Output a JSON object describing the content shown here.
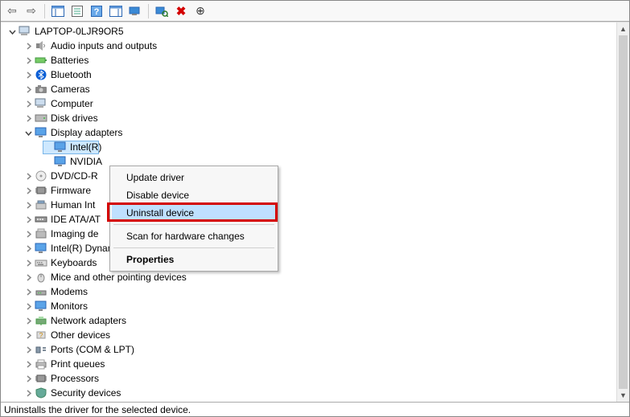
{
  "root_label": "LAPTOP-0LJR9OR5",
  "categories": [
    {
      "label": "Audio inputs and outputs",
      "expanded": false,
      "children": []
    },
    {
      "label": "Batteries",
      "expanded": false,
      "children": []
    },
    {
      "label": "Bluetooth",
      "expanded": false,
      "children": []
    },
    {
      "label": "Cameras",
      "expanded": false,
      "children": []
    },
    {
      "label": "Computer",
      "expanded": false,
      "children": []
    },
    {
      "label": "Disk drives",
      "expanded": false,
      "children": []
    },
    {
      "label": "Display adapters",
      "expanded": true,
      "children": [
        {
          "label": "Intel(R)",
          "selected": true
        },
        {
          "label": "NVIDIA"
        }
      ]
    },
    {
      "label": "DVD/CD-R",
      "expanded": false,
      "children": []
    },
    {
      "label": "Firmware",
      "expanded": false,
      "children": []
    },
    {
      "label": "Human Int",
      "expanded": false,
      "children": []
    },
    {
      "label": "IDE ATA/AT",
      "expanded": false,
      "children": []
    },
    {
      "label": "Imaging de",
      "expanded": false,
      "children": []
    },
    {
      "label": "Intel(R) Dynamic Platform and Thermal Framework",
      "expanded": false,
      "children": []
    },
    {
      "label": "Keyboards",
      "expanded": false,
      "children": []
    },
    {
      "label": "Mice and other pointing devices",
      "expanded": false,
      "children": []
    },
    {
      "label": "Modems",
      "expanded": false,
      "children": []
    },
    {
      "label": "Monitors",
      "expanded": false,
      "children": []
    },
    {
      "label": "Network adapters",
      "expanded": false,
      "children": []
    },
    {
      "label": "Other devices",
      "expanded": false,
      "children": []
    },
    {
      "label": "Ports (COM & LPT)",
      "expanded": false,
      "children": []
    },
    {
      "label": "Print queues",
      "expanded": false,
      "children": []
    },
    {
      "label": "Processors",
      "expanded": false,
      "children": []
    },
    {
      "label": "Security devices",
      "expanded": false,
      "children": []
    }
  ],
  "context_menu": {
    "items": [
      {
        "label": "Update driver",
        "type": "item"
      },
      {
        "label": "Disable device",
        "type": "item"
      },
      {
        "label": "Uninstall device",
        "type": "item",
        "hovered": true,
        "highlighted": true
      },
      {
        "type": "sep"
      },
      {
        "label": "Scan for hardware changes",
        "type": "item"
      },
      {
        "type": "sep"
      },
      {
        "label": "Properties",
        "type": "item",
        "bold": true
      }
    ]
  },
  "statusbar_text": "Uninstalls the driver for the selected device.",
  "toolbar_icons": [
    "back-arrow",
    "forward-arrow",
    "sep",
    "show-hidden",
    "properties-sheet",
    "help",
    "action-pane",
    "remote-computer",
    "sep",
    "scan-hardware",
    "uninstall-x",
    "disable-down"
  ],
  "colors": {
    "selection_bg": "#cde8ff",
    "selection_border": "#7bb6e8",
    "context_hover": "#bfe0ff",
    "highlight_red": "#d40000",
    "bluetooth_blue": "#0a5fd6"
  }
}
